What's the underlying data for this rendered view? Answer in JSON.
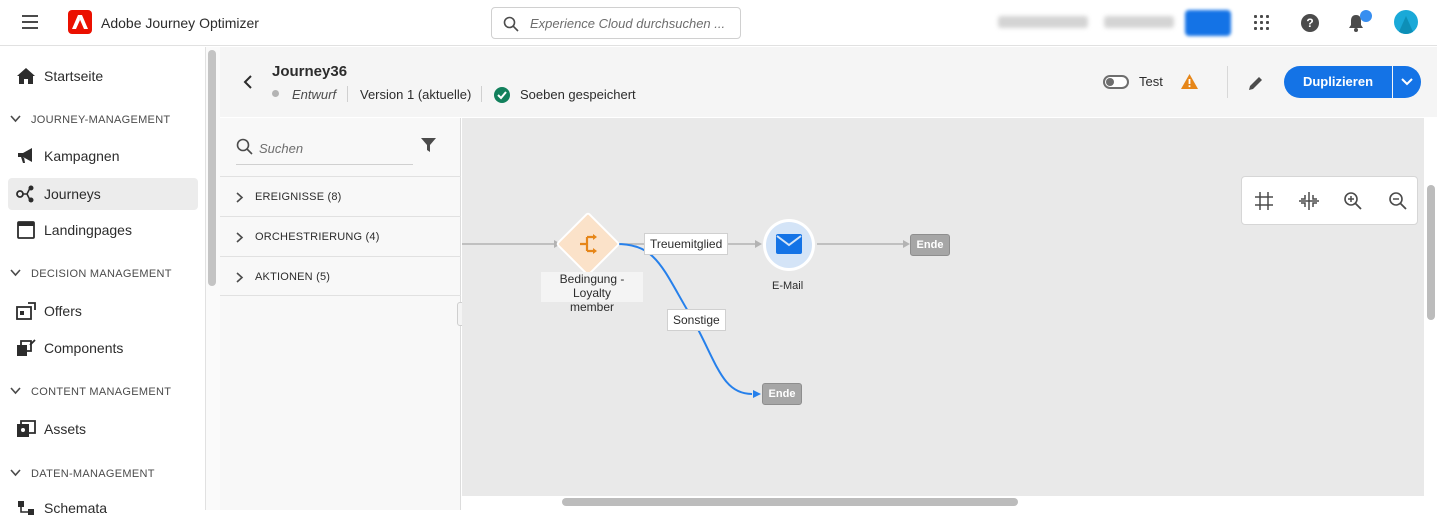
{
  "app": {
    "name": "Adobe Journey Optimizer",
    "search_placeholder": "Experience Cloud durchsuchen ..."
  },
  "sidebar": {
    "items": [
      {
        "label": "Startseite",
        "icon": "home-icon"
      },
      {
        "label": "Kampagnen",
        "icon": "megaphone-icon"
      },
      {
        "label": "Journeys",
        "icon": "journey-icon",
        "active": true
      },
      {
        "label": "Landingpages",
        "icon": "landing-page-icon"
      },
      {
        "label": "Offers",
        "icon": "offer-icon"
      },
      {
        "label": "Components",
        "icon": "components-icon"
      },
      {
        "label": "Assets",
        "icon": "assets-icon"
      },
      {
        "label": "Schemata",
        "icon": "schema-icon"
      }
    ],
    "sections": [
      {
        "label": "JOURNEY-MANAGEMENT"
      },
      {
        "label": "DECISION MANAGEMENT"
      },
      {
        "label": "CONTENT MANAGEMENT"
      },
      {
        "label": "DATEN-MANAGEMENT"
      }
    ]
  },
  "journey": {
    "title": "Journey36",
    "status": "Entwurf",
    "version": "Version 1 (aktuelle)",
    "saved": "Soeben gespeichert",
    "test_label": "Test",
    "duplicate_label": "Duplizieren"
  },
  "palette": {
    "search_placeholder": "Suchen",
    "categories": [
      {
        "label": "EREIGNISSE (8)"
      },
      {
        "label": "ORCHESTRIERUNG (4)"
      },
      {
        "label": "AKTIONEN (5)"
      }
    ]
  },
  "canvas": {
    "condition_label_line1": "Bedingung - Loyalty",
    "condition_label_line2": "member",
    "edge_loyal": "Treuemitglied",
    "edge_other": "Sonstige",
    "email_label": "E-Mail",
    "end_label": "Ende"
  },
  "colors": {
    "accent": "#1473e6",
    "saved": "#12805c",
    "warning": "#e68619",
    "condition": "#e68619"
  }
}
